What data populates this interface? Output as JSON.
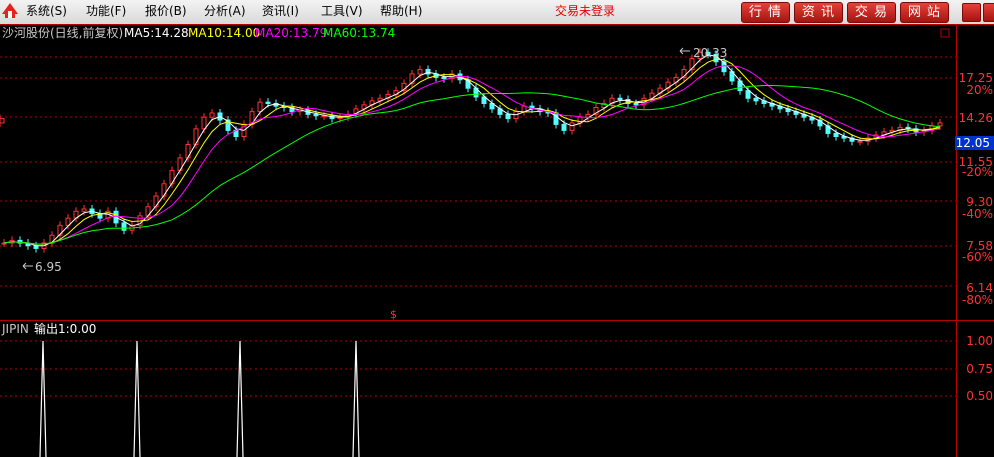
{
  "menu": {
    "items": [
      "系统(S)",
      "功能(F)",
      "报价(B)",
      "分析(A)",
      "资讯(I)",
      "工具(V)",
      "帮助(H)"
    ],
    "status": "交易未登录",
    "right_buttons": [
      "行 情",
      "资 讯",
      "交 易",
      "网 站"
    ]
  },
  "colors": {
    "background": "#000000",
    "axis": "#b40000",
    "up": "#ff3232",
    "down": "#54ffff",
    "ma5": "#ffffff",
    "ma10": "#ffff00",
    "ma20": "#ff00ff",
    "ma60": "#00ff00",
    "signal": "#ffffff",
    "price_tag": "#0033cc"
  },
  "main_panel": {
    "title": "沙河股份(日线,前复权)",
    "ma_labels": [
      "MA5:14.28",
      "MA10:14.00",
      "MA20:13.79",
      "MA60:13.74"
    ],
    "high_label": "20.33",
    "low_label": "6.95",
    "current_price": "12.05",
    "y_ticks": [
      "17.25",
      "14.26",
      "11.55",
      "9.30",
      "7.58",
      "6.14"
    ],
    "pct_ticks": [
      "20%",
      "-20%",
      "-40%",
      "-60%",
      "-80%"
    ],
    "marker": "$"
  },
  "sub_panel": {
    "title": "JIPIN",
    "output_label": "输出1:0.00",
    "y_ticks": [
      "1.00",
      "0.75",
      "0.50"
    ]
  },
  "chart_data": [
    {
      "type": "candlestick",
      "title": "沙河股份(日线,前复权)",
      "x": [
        0,
        8,
        16,
        24,
        32,
        40,
        48,
        56,
        64,
        72,
        80,
        88,
        96,
        104,
        112,
        120,
        128,
        136,
        144,
        152,
        160,
        168,
        176,
        184,
        192,
        200,
        208,
        216,
        224,
        232,
        240,
        248,
        256,
        264,
        272,
        280,
        288,
        296,
        304,
        312,
        320,
        328,
        336,
        344,
        352,
        360,
        368,
        376,
        384,
        392,
        400,
        408,
        416,
        424,
        432,
        440,
        448,
        456,
        464,
        472,
        480,
        488,
        496,
        504,
        512,
        520,
        528,
        536,
        544,
        552,
        560,
        568,
        576,
        584,
        592,
        600,
        608,
        616,
        624,
        632,
        640,
        648,
        656,
        664,
        672,
        680,
        688,
        696,
        704,
        712,
        720,
        728,
        736,
        744,
        752,
        760,
        768,
        776,
        784,
        792,
        800,
        808,
        816,
        824,
        832,
        840,
        848,
        856,
        864,
        872,
        880,
        888,
        896,
        904,
        912,
        920,
        928,
        936
      ],
      "close": [
        7.6,
        7.7,
        7.6,
        7.5,
        7.4,
        7.6,
        7.9,
        8.3,
        8.6,
        8.9,
        9.0,
        8.8,
        8.6,
        8.9,
        8.4,
        8.1,
        8.3,
        8.7,
        9.1,
        9.6,
        10.2,
        10.9,
        11.6,
        12.4,
        13.4,
        14.2,
        14.5,
        14.0,
        13.3,
        12.9,
        13.7,
        14.6,
        15.3,
        15.2,
        15.0,
        14.9,
        14.6,
        14.7,
        14.4,
        14.3,
        14.3,
        14.1,
        14.2,
        14.4,
        14.8,
        15.1,
        15.4,
        15.6,
        15.9,
        16.2,
        16.8,
        17.6,
        18.0,
        17.6,
        17.3,
        17.2,
        17.6,
        17.1,
        16.4,
        15.7,
        15.2,
        14.8,
        14.4,
        14.1,
        14.6,
        15.0,
        14.8,
        14.6,
        14.5,
        13.7,
        13.3,
        13.8,
        14.2,
        14.4,
        14.9,
        15.2,
        15.6,
        15.5,
        15.2,
        15.1,
        15.6,
        16.0,
        16.4,
        16.9,
        17.3,
        18.0,
        19.0,
        19.6,
        19.4,
        18.7,
        17.8,
        17.0,
        16.2,
        15.6,
        15.4,
        15.2,
        15.0,
        14.8,
        14.6,
        14.4,
        14.2,
        14.0,
        13.6,
        13.1,
        12.9,
        12.8,
        12.6,
        12.6,
        12.8,
        13.0,
        13.2,
        13.3,
        13.5,
        13.4,
        13.2,
        13.3,
        13.6,
        13.8,
        14.1
      ],
      "signal_x": [
        43,
        137,
        240,
        356
      ],
      "axis_ticks": [
        "17.25",
        "14.26",
        "11.55",
        "9.30",
        "7.58",
        "6.14"
      ],
      "pct_ticks": [
        "20%",
        "-20%",
        "-40%",
        "-60%",
        "-80%"
      ],
      "high": 20.33,
      "low": 6.95,
      "current": 12.05
    }
  ]
}
